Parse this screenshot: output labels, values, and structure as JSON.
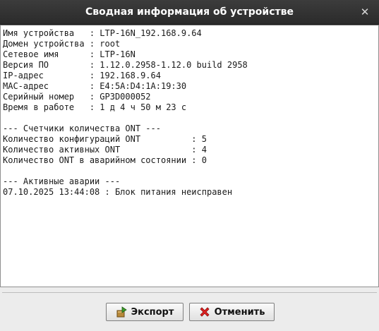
{
  "window": {
    "title": "Сводная информация об устройстве",
    "close_glyph": "✕"
  },
  "info": {
    "lines": [
      "Имя устройства   : LTP-16N_192.168.9.64",
      "Домен устройства : root",
      "Сетевое имя      : LTP-16N",
      "Версия ПО        : 1.12.0.2958-1.12.0 build 2958",
      "IP-адрес         : 192.168.9.64",
      "MAC-адрес        : E4:5A:D4:1A:19:30",
      "Серийный номер   : GP3D000052",
      "Время в работе   : 1 д 4 ч 50 м 23 с",
      "",
      "--- Счетчики количества ONT ---",
      "Количество конфигураций ONT          : 5",
      "Количество активных ONT              : 4",
      "Количество ONT в аварийном состоянии : 0",
      "",
      "--- Активные аварии ---",
      "07.10.2025 13:44:08 : Блок питания неисправен"
    ]
  },
  "buttons": {
    "export": {
      "label": "Экспорт",
      "icon": "export-icon",
      "color": "#8a6a2a"
    },
    "cancel": {
      "label": "Отменить",
      "icon": "cancel-x-icon",
      "color": "#d01818"
    }
  }
}
